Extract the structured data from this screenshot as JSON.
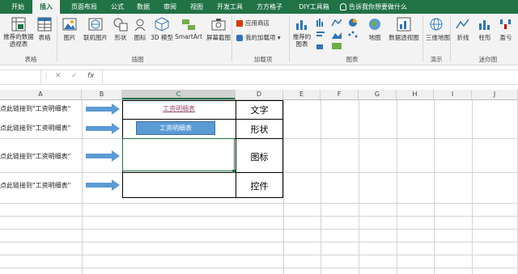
{
  "tabs": [
    "开始",
    "插入",
    "页面布局",
    "公式",
    "数据",
    "审阅",
    "视图",
    "开发工具",
    "方方格子",
    "DIY工具箱"
  ],
  "tell_me": "告诉我你想要做什么",
  "ribbon": {
    "pivot": "推荐的数据透视表",
    "table": "表格",
    "pictures": "图片",
    "online_pictures": "联机图片",
    "shapes": "形状",
    "icons": "图标",
    "model3d": "3D 模型",
    "smartart": "SmartArt",
    "screenshot": "屏幕截图",
    "app_store": "应用商店",
    "my_addins": "我的加载项",
    "rec_charts": "推荐的图表",
    "maps": "地图",
    "pivot_chart": "数据透视图",
    "map3d": "三维地图",
    "line": "折线",
    "column": "柱形",
    "winloss": "盈亏",
    "groups": {
      "tables": "表格",
      "illustrations": "插图",
      "addins": "加载项",
      "charts": "图表",
      "tours": "演示",
      "sparklines": "迷你图"
    }
  },
  "formula_bar": {
    "fx": "fx"
  },
  "columns": [
    "A",
    "B",
    "C",
    "D",
    "E",
    "F",
    "G",
    "H",
    "I",
    "J"
  ],
  "rows": [
    {
      "a": "点此链接到\"工资明细表\"",
      "c": "工资明细表",
      "d": "文字"
    },
    {
      "a": "点此链接到\"工资明细表\"",
      "c": "工资明细表",
      "d": "形状"
    },
    {
      "a": "点此链接到\"工资明细表\"",
      "c": "",
      "d": "图标"
    },
    {
      "a": "点此链接到\"工资明细表\"",
      "c": "",
      "d": "控件"
    }
  ],
  "colors": {
    "excel_green": "#217346",
    "shape_blue": "#5b9bd5",
    "link_color": "#954f72"
  }
}
